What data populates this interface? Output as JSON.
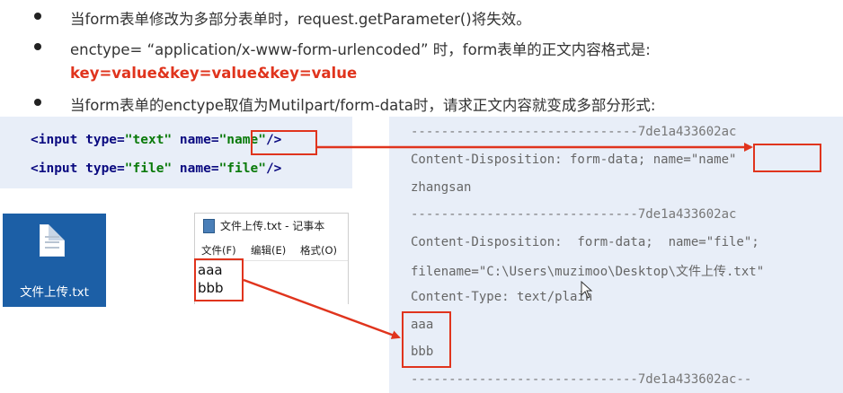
{
  "bullets": [
    "当form表单修改为多部分表单时，request.getParameter()将失效。",
    "enctype= “application/x-www-form-urlencoded” 时，form表单的正文内容格式是:",
    "当form表单的enctype取值为Mutilpart/form-data时，请求正文内容就变成多部分形式:"
  ],
  "format_line": "key=value&key=value&key=value",
  "code_lines": [
    {
      "tag": "<input",
      "attr1": " type=",
      "val1": "\"text\"",
      "attr2": " name=",
      "val2": "\"name\"",
      "end": "/>"
    },
    {
      "tag": "<input",
      "attr1": " type=",
      "val1": "\"file\"",
      "attr2": " name=",
      "val2": "\"file\"",
      "end": "/>"
    }
  ],
  "file_tile": {
    "label": "文件上传.txt",
    "icon": "text-file-icon"
  },
  "notepad": {
    "title": "文件上传.txt - 记事本",
    "menu": [
      "文件(F)",
      "编辑(E)",
      "格式(O)"
    ],
    "lines": [
      "aaa",
      "bbb"
    ]
  },
  "request_body": [
    "------------------------------7de1a433602ac",
    "Content-Disposition: form-data; name=\"name\"",
    "zhangsan",
    "------------------------------7de1a433602ac",
    "Content-Disposition:  form-data;  name=\"file\";",
    "filename=\"C:\\Users\\muzimoo\\Desktop\\文件上传.txt\"",
    "Content-Type: text/plain",
    "aaa",
    "bbb",
    "------------------------------7de1a433602ac--"
  ],
  "colors": {
    "highlight": "#e0341d",
    "panel": "#e8eef8",
    "tile": "#1c5fa6"
  }
}
